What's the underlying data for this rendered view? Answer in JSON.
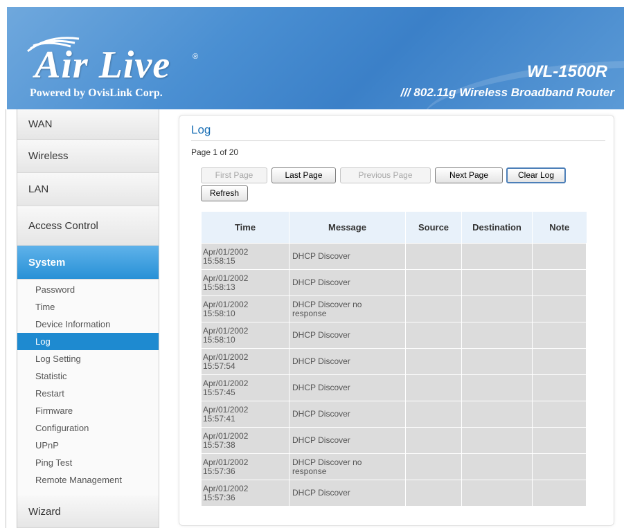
{
  "header": {
    "brand": "Air Live",
    "brand_reg": "®",
    "tagline": "Powered by OvisLink Corp.",
    "model": "WL-1500R",
    "product": "/// 802.11g Wireless Broadband Router"
  },
  "nav": {
    "main": [
      {
        "label": "WAN"
      },
      {
        "label": "Wireless"
      },
      {
        "label": "LAN"
      },
      {
        "label": "Access Control"
      },
      {
        "label": "System",
        "active": true
      },
      {
        "label": "Wizard"
      }
    ],
    "sub": [
      {
        "label": "Password"
      },
      {
        "label": "Time"
      },
      {
        "label": "Device Information"
      },
      {
        "label": "Log",
        "active": true
      },
      {
        "label": "Log Setting"
      },
      {
        "label": "Statistic"
      },
      {
        "label": "Restart"
      },
      {
        "label": "Firmware"
      },
      {
        "label": "Configuration"
      },
      {
        "label": "UPnP"
      },
      {
        "label": "Ping Test"
      },
      {
        "label": "Remote Management"
      }
    ]
  },
  "main": {
    "title": "Log",
    "page_info": "Page 1 of 20",
    "buttons": {
      "first_page": "First Page",
      "last_page": "Last Page",
      "previous_page": "Previous Page",
      "next_page": "Next Page",
      "clear_log": "Clear Log",
      "refresh": "Refresh"
    },
    "table": {
      "headers": [
        "Time",
        "Message",
        "Source",
        "Destination",
        "Note"
      ],
      "rows": [
        {
          "date": "Apr/01/2002",
          "time": "15:58:15",
          "msg1": "DHCP Discover",
          "msg2": "",
          "source": "",
          "destination": "",
          "note": ""
        },
        {
          "date": "Apr/01/2002",
          "time": "15:58:13",
          "msg1": "DHCP Discover",
          "msg2": "",
          "source": "",
          "destination": "",
          "note": ""
        },
        {
          "date": "Apr/01/2002",
          "time": "15:58:10",
          "msg1": "DHCP Discover no",
          "msg2": "response",
          "source": "",
          "destination": "",
          "note": ""
        },
        {
          "date": "Apr/01/2002",
          "time": "15:58:10",
          "msg1": "DHCP Discover",
          "msg2": "",
          "source": "",
          "destination": "",
          "note": ""
        },
        {
          "date": "Apr/01/2002",
          "time": "15:57:54",
          "msg1": "DHCP Discover",
          "msg2": "",
          "source": "",
          "destination": "",
          "note": ""
        },
        {
          "date": "Apr/01/2002",
          "time": "15:57:45",
          "msg1": "DHCP Discover",
          "msg2": "",
          "source": "",
          "destination": "",
          "note": ""
        },
        {
          "date": "Apr/01/2002",
          "time": "15:57:41",
          "msg1": "DHCP Discover",
          "msg2": "",
          "source": "",
          "destination": "",
          "note": ""
        },
        {
          "date": "Apr/01/2002",
          "time": "15:57:38",
          "msg1": "DHCP Discover",
          "msg2": "",
          "source": "",
          "destination": "",
          "note": ""
        },
        {
          "date": "Apr/01/2002",
          "time": "15:57:36",
          "msg1": "DHCP Discover no",
          "msg2": "response",
          "source": "",
          "destination": "",
          "note": ""
        },
        {
          "date": "Apr/01/2002",
          "time": "15:57:36",
          "msg1": "DHCP Discover",
          "msg2": "",
          "source": "",
          "destination": "",
          "note": ""
        }
      ]
    }
  },
  "colors": {
    "banner_blue": "#4a8fd2",
    "nav_active": "#2891d6",
    "sub_active": "#1e8ad0",
    "title_blue": "#1a6fb5",
    "table_header": "#e8f1fa",
    "table_cell": "#dcdcdc"
  }
}
